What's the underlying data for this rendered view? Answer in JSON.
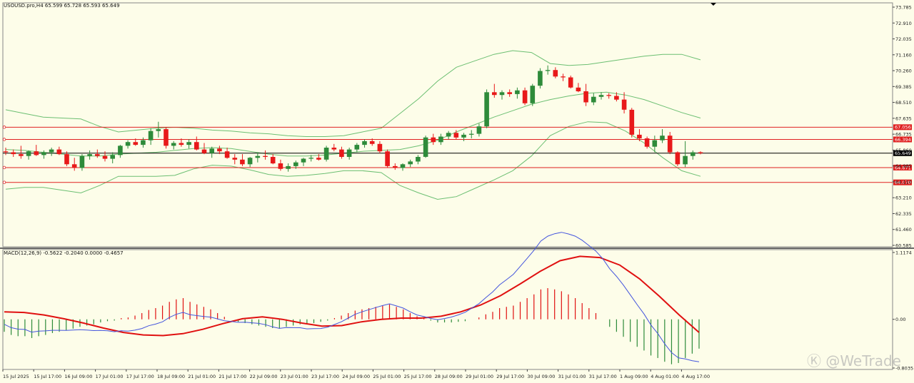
{
  "header": {
    "symbol_info": "USOUSD.pro,H4  65.599 65.728 65.593 65.649",
    "macd_info": "MACD(12,26,9) -0.5622 -0.2040 0.0000 -0.4657"
  },
  "watermark": "Ⓚ @WeTrade",
  "colors": {
    "bull": "#2e8b3a",
    "bear": "#e8191a",
    "band": "#6cbf72",
    "signal": "#e01010",
    "macd_line": "#4455dd",
    "hline": "#e02020",
    "bg": "#fdfde9"
  },
  "chart_data": [
    {
      "type": "candlestick",
      "title": "USOUSD.pro,H4",
      "x_labels": [
        "15 Jul 2025",
        "15 Jul 17:00",
        "16 Jul 09:00",
        "17 Jul 01:00",
        "17 Jul 17:00",
        "18 Jul 09:00",
        "21 Jul 01:00",
        "21 Jul 17:00",
        "22 Jul 09:00",
        "23 Jul 01:00",
        "23 Jul 17:00",
        "24 Jul 09:00",
        "25 Jul 01:00",
        "25 Jul 17:00",
        "28 Jul 09:00",
        "29 Jul 01:00",
        "29 Jul 17:00",
        "30 Jul 09:00",
        "31 Jul 01:00",
        "31 Jul 17:00",
        "1 Aug 09:00",
        "4 Aug 01:00",
        "4 Aug 17:00"
      ],
      "y_ticks": [
        "73.785",
        "72.910",
        "72.035",
        "71.160",
        "70.260",
        "69.385",
        "68.510",
        "67.635",
        "66.735",
        "65.860",
        "64.985",
        "64.110",
        "63.210",
        "62.335",
        "61.460",
        "60.585"
      ],
      "ylim": [
        60.585,
        73.785
      ],
      "price_lines": [
        {
          "label": "67.056",
          "value": 67.056
        },
        {
          "label": "66.394",
          "value": 66.394
        },
        {
          "label": "64.871",
          "value": 64.871
        },
        {
          "label": "64.070",
          "value": 64.07
        }
      ],
      "current_price": {
        "label": "65.649",
        "value": 65.649
      },
      "candles": [
        [
          65.75,
          65.95,
          65.55,
          65.7
        ],
        [
          65.7,
          65.85,
          65.45,
          65.6
        ],
        [
          65.6,
          66.05,
          65.35,
          65.5
        ],
        [
          65.5,
          65.8,
          65.3,
          65.75
        ],
        [
          65.75,
          66.1,
          65.5,
          65.55
        ],
        [
          65.55,
          65.8,
          65.35,
          65.7
        ],
        [
          65.7,
          65.95,
          65.5,
          65.85
        ],
        [
          65.85,
          66.0,
          65.55,
          65.6
        ],
        [
          65.6,
          65.75,
          64.95,
          65.05
        ],
        [
          65.05,
          65.4,
          64.7,
          64.85
        ],
        [
          64.85,
          65.6,
          64.7,
          65.5
        ],
        [
          65.5,
          65.8,
          65.3,
          65.6
        ],
        [
          65.6,
          65.85,
          65.4,
          65.5
        ],
        [
          65.5,
          65.75,
          65.2,
          65.35
        ],
        [
          65.35,
          65.7,
          65.1,
          65.55
        ],
        [
          65.55,
          66.1,
          65.4,
          66.05
        ],
        [
          66.05,
          66.35,
          65.9,
          66.25
        ],
        [
          66.25,
          66.45,
          66.05,
          66.1
        ],
        [
          66.1,
          66.5,
          65.95,
          66.35
        ],
        [
          66.35,
          67.0,
          66.1,
          66.85
        ],
        [
          66.85,
          67.35,
          66.5,
          66.95
        ],
        [
          66.95,
          67.05,
          65.9,
          66.05
        ],
        [
          66.05,
          66.3,
          65.85,
          66.2
        ],
        [
          66.2,
          66.45,
          66.0,
          66.1
        ],
        [
          66.1,
          66.4,
          65.9,
          66.25
        ],
        [
          66.25,
          66.55,
          65.8,
          65.85
        ],
        [
          65.85,
          66.2,
          65.6,
          65.65
        ],
        [
          65.65,
          66.0,
          65.4,
          65.9
        ],
        [
          65.9,
          66.05,
          65.6,
          65.75
        ],
        [
          65.75,
          65.95,
          65.35,
          65.4
        ],
        [
          65.4,
          65.6,
          65.05,
          65.3
        ],
        [
          65.3,
          65.6,
          64.95,
          65.05
        ],
        [
          65.05,
          65.45,
          64.9,
          65.4
        ],
        [
          65.4,
          65.7,
          65.15,
          65.5
        ],
        [
          65.5,
          65.8,
          65.3,
          65.45
        ],
        [
          65.45,
          65.6,
          65.05,
          65.1
        ],
        [
          65.1,
          65.3,
          64.7,
          64.8
        ],
        [
          64.8,
          65.1,
          64.65,
          64.95
        ],
        [
          64.95,
          65.25,
          64.8,
          65.15
        ],
        [
          65.15,
          65.4,
          64.95,
          65.35
        ],
        [
          65.35,
          65.55,
          65.2,
          65.4
        ],
        [
          65.4,
          65.6,
          65.25,
          65.3
        ],
        [
          65.3,
          66.05,
          65.2,
          65.95
        ],
        [
          65.95,
          66.15,
          65.75,
          65.85
        ],
        [
          65.85,
          66.0,
          65.35,
          65.45
        ],
        [
          65.45,
          65.95,
          65.3,
          65.85
        ],
        [
          65.85,
          66.2,
          65.7,
          66.1
        ],
        [
          66.1,
          66.4,
          65.95,
          66.3
        ],
        [
          66.3,
          66.45,
          66.05,
          66.15
        ],
        [
          66.15,
          66.3,
          65.65,
          65.75
        ],
        [
          65.75,
          65.85,
          64.85,
          64.95
        ],
        [
          64.95,
          65.1,
          64.75,
          64.85
        ],
        [
          64.85,
          65.1,
          64.7,
          65.05
        ],
        [
          65.05,
          65.3,
          64.9,
          65.2
        ],
        [
          65.2,
          65.55,
          65.05,
          65.45
        ],
        [
          65.45,
          66.6,
          65.4,
          66.5
        ],
        [
          66.5,
          66.7,
          66.1,
          66.25
        ],
        [
          66.25,
          66.7,
          66.1,
          66.55
        ],
        [
          66.55,
          66.85,
          66.4,
          66.75
        ],
        [
          66.75,
          66.9,
          66.4,
          66.5
        ],
        [
          66.5,
          66.75,
          66.3,
          66.65
        ],
        [
          66.65,
          66.9,
          66.45,
          66.7
        ],
        [
          66.7,
          67.25,
          66.55,
          67.1
        ],
        [
          67.1,
          69.1,
          67.0,
          68.95
        ],
        [
          68.95,
          69.4,
          68.65,
          68.8
        ],
        [
          68.8,
          69.05,
          68.55,
          68.95
        ],
        [
          68.95,
          69.1,
          68.7,
          68.85
        ],
        [
          68.85,
          69.2,
          68.6,
          69.05
        ],
        [
          69.05,
          69.2,
          68.25,
          68.35
        ],
        [
          68.35,
          69.4,
          68.2,
          69.3
        ],
        [
          69.3,
          70.25,
          69.15,
          70.1
        ],
        [
          70.1,
          70.4,
          69.9,
          70.15
        ],
        [
          70.15,
          70.3,
          69.7,
          69.8
        ],
        [
          69.8,
          69.95,
          69.55,
          69.75
        ],
        [
          69.75,
          69.85,
          69.15,
          69.2
        ],
        [
          69.2,
          69.45,
          68.95,
          69.0
        ],
        [
          69.0,
          69.4,
          68.2,
          68.4
        ],
        [
          68.4,
          68.9,
          68.25,
          68.7
        ],
        [
          68.7,
          68.95,
          68.55,
          68.8
        ],
        [
          68.8,
          68.9,
          68.6,
          68.75
        ],
        [
          68.75,
          68.95,
          68.45,
          68.55
        ],
        [
          68.55,
          68.95,
          67.8,
          68.0
        ],
        [
          68.0,
          68.1,
          66.5,
          66.65
        ],
        [
          66.65,
          66.95,
          66.3,
          66.45
        ],
        [
          66.45,
          66.55,
          65.9,
          66.0
        ],
        [
          66.0,
          66.6,
          65.7,
          66.35
        ],
        [
          66.35,
          66.95,
          66.2,
          66.6
        ],
        [
          66.6,
          66.8,
          65.6,
          65.7
        ],
        [
          65.7,
          65.75,
          64.95,
          65.05
        ],
        [
          65.05,
          66.3,
          64.9,
          65.5
        ],
        [
          65.5,
          65.8,
          65.3,
          65.7
        ],
        [
          65.7,
          65.75,
          65.59,
          65.65
        ]
      ],
      "bollinger": {
        "upper": [
          68.0,
          67.8,
          67.6,
          67.55,
          67.5,
          67.1,
          66.8,
          66.9,
          67.0,
          67.05,
          67.0,
          66.9,
          66.85,
          66.75,
          66.7,
          66.6,
          66.55,
          66.55,
          66.6,
          66.8,
          67.0,
          67.8,
          68.6,
          69.55,
          70.3,
          70.65,
          71.0,
          71.2,
          71.1,
          70.5,
          70.4,
          70.45,
          70.6,
          70.75,
          70.9,
          71.0,
          71.0,
          70.7
        ],
        "middle": [
          65.85,
          65.8,
          65.7,
          65.6,
          65.5,
          65.5,
          65.6,
          65.65,
          65.7,
          65.8,
          65.9,
          65.95,
          65.9,
          65.75,
          65.6,
          65.5,
          65.5,
          65.55,
          65.65,
          65.75,
          65.8,
          65.85,
          66.05,
          66.35,
          66.8,
          67.2,
          67.6,
          67.95,
          68.3,
          68.55,
          68.75,
          68.9,
          68.95,
          68.8,
          68.55,
          68.2,
          67.85,
          67.55
        ],
        "lower": [
          63.7,
          63.8,
          63.8,
          63.65,
          63.5,
          63.9,
          64.4,
          64.4,
          64.4,
          64.45,
          64.8,
          65.0,
          64.95,
          64.75,
          64.5,
          64.4,
          64.45,
          64.55,
          64.7,
          64.7,
          64.6,
          63.9,
          63.5,
          63.15,
          63.3,
          63.75,
          64.2,
          64.7,
          65.5,
          66.6,
          67.1,
          67.35,
          67.3,
          66.85,
          66.2,
          65.4,
          64.7,
          64.4
        ]
      }
    },
    {
      "type": "macd",
      "title": "MACD(12,26,9) -0.5622 -0.2040 0.0000 -0.4657",
      "y_ticks": [
        "1.1174",
        "0.00",
        "-0.8035"
      ],
      "ylim": [
        -0.8035,
        1.1174
      ],
      "histogram": [
        -0.2,
        -0.25,
        -0.27,
        -0.27,
        -0.3,
        -0.27,
        -0.25,
        -0.22,
        -0.2,
        -0.18,
        -0.15,
        -0.12,
        -0.1,
        -0.08,
        -0.05,
        -0.03,
        -0.02,
        0.02,
        0.03,
        0.06,
        0.1,
        0.15,
        0.18,
        0.22,
        0.28,
        0.32,
        0.34,
        0.28,
        0.24,
        0.2,
        0.16,
        0.1,
        0.04,
        0.0,
        -0.04,
        -0.06,
        -0.08,
        -0.1,
        -0.12,
        -0.14,
        -0.15,
        -0.12,
        -0.1,
        -0.08,
        -0.08,
        -0.06,
        -0.04,
        -0.02,
        0.02,
        0.06,
        0.1,
        0.14,
        0.16,
        0.18,
        0.2,
        0.22,
        0.24,
        0.2,
        0.16,
        0.1,
        0.05,
        0.02,
        -0.02,
        -0.05,
        -0.05,
        -0.05,
        -0.04,
        -0.03,
        0.0,
        0.03,
        0.08,
        0.12,
        0.18,
        0.2,
        0.22,
        0.28,
        0.34,
        0.4,
        0.48,
        0.5,
        0.48,
        0.45,
        0.4,
        0.34,
        0.26,
        0.18,
        0.1,
        0.0,
        -0.12,
        -0.2,
        -0.28,
        -0.36,
        -0.44,
        -0.5,
        -0.58,
        -0.62,
        -0.68,
        -0.72,
        -0.7,
        -0.62,
        -0.55,
        -0.47
      ],
      "signal": [
        0.12,
        0.11,
        0.07,
        0.01,
        -0.06,
        -0.14,
        -0.21,
        -0.25,
        -0.26,
        -0.23,
        -0.16,
        -0.07,
        0.01,
        0.04,
        0.0,
        -0.06,
        -0.11,
        -0.1,
        -0.04,
        0.0,
        0.02,
        0.02,
        0.05,
        0.12,
        0.23,
        0.38,
        0.57,
        0.77,
        0.94,
        1.01,
        0.99,
        0.87,
        0.65,
        0.37,
        0.07,
        -0.21
      ]
    }
  ]
}
